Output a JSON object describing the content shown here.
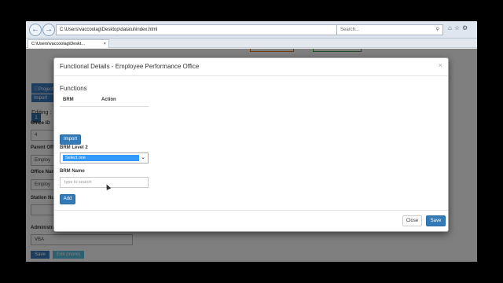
{
  "browser": {
    "address": "C:\\Users\\vaccoolag\\Desktop\\data\\ui\\index.html",
    "search_placeholder": "Search...",
    "tab_title": "C:\\Users\\vaccoolag\\Deskt...",
    "tab_close": "×"
  },
  "background": {
    "badge": "1",
    "project_btn": "Project",
    "import_btn": "Import",
    "editing_label": "Editing :",
    "office_id_label": "Office ID",
    "office_id_value": "4",
    "parent_office_label": "Parent Off",
    "parent_office_value": "Employ",
    "office_name_label": "Office Nam",
    "office_name_value": "Employ",
    "station_label": "Station Nu",
    "admin_label": "Administration of Staff Office",
    "admin_value": "VBA",
    "save_btn": "Save",
    "edit_btn": "Edit (more)"
  },
  "modal": {
    "title": "Functional Details - Employee Performance Office",
    "close_glyph": "×",
    "functions_heading": "Functions",
    "table_headers": [
      "BRM",
      "Action"
    ],
    "import_button": "Import",
    "brm_level2_label": "BRM Level 2",
    "brm_level2_selected": "Select one",
    "brm_name_label": "BRM Name",
    "brm_name_placeholder": "type to search",
    "add_button": "Add",
    "close_button": "Close",
    "save_button": "Save"
  }
}
